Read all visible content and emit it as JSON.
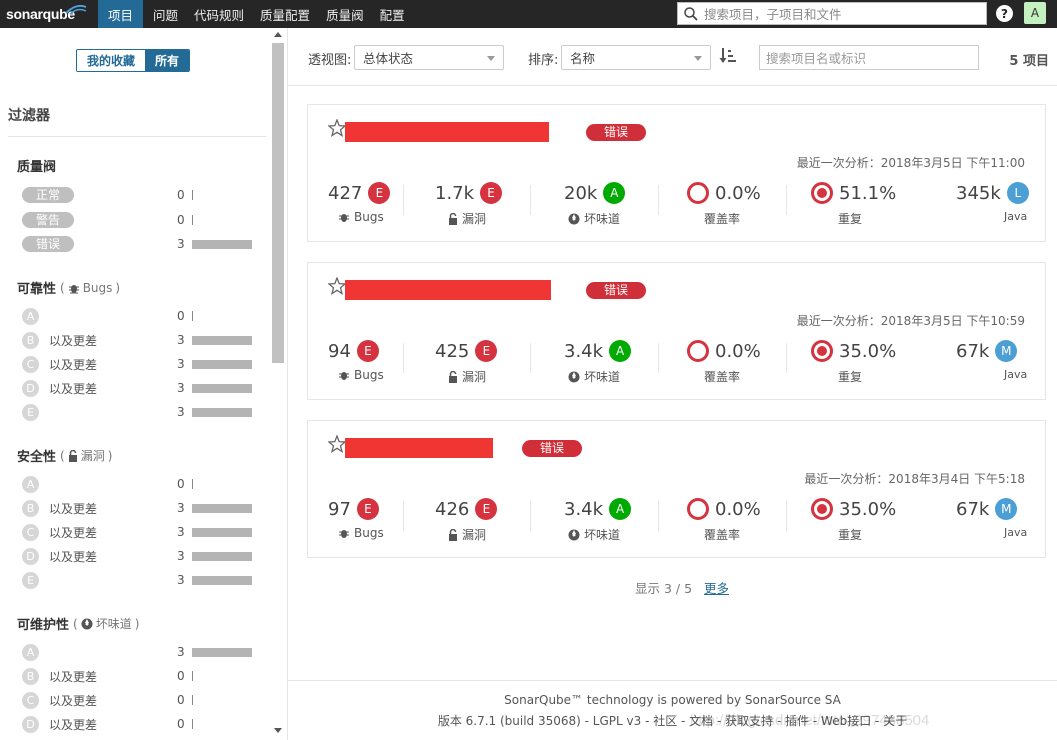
{
  "nav": {
    "logo": "sonarqube",
    "items": [
      "项目",
      "问题",
      "代码规则",
      "质量配置",
      "质量阀",
      "配置"
    ],
    "search_placeholder": "搜索项目，子项目和文件",
    "help": "?",
    "avatar": "A"
  },
  "sidebar": {
    "toggle": {
      "favorites": "我的收藏",
      "all": "所有"
    },
    "filter_title": "过滤器",
    "quality_gate": {
      "title": "质量阀",
      "rows": [
        {
          "label": "正常",
          "count": "0",
          "bar": 0
        },
        {
          "label": "警告",
          "count": "0",
          "bar": 0
        },
        {
          "label": "错误",
          "count": "3",
          "bar": 1
        }
      ]
    },
    "reliability": {
      "title": "可靠性",
      "sub": "Bugs",
      "rows": [
        {
          "rating": "A",
          "worse": "",
          "count": "0",
          "bar": 0
        },
        {
          "rating": "B",
          "worse": "以及更差",
          "count": "3",
          "bar": 1
        },
        {
          "rating": "C",
          "worse": "以及更差",
          "count": "3",
          "bar": 1
        },
        {
          "rating": "D",
          "worse": "以及更差",
          "count": "3",
          "bar": 1
        },
        {
          "rating": "E",
          "worse": "",
          "count": "3",
          "bar": 1
        }
      ]
    },
    "security": {
      "title": "安全性",
      "sub": "漏洞",
      "rows": [
        {
          "rating": "A",
          "worse": "",
          "count": "0",
          "bar": 0
        },
        {
          "rating": "B",
          "worse": "以及更差",
          "count": "3",
          "bar": 1
        },
        {
          "rating": "C",
          "worse": "以及更差",
          "count": "3",
          "bar": 1
        },
        {
          "rating": "D",
          "worse": "以及更差",
          "count": "3",
          "bar": 1
        },
        {
          "rating": "E",
          "worse": "",
          "count": "3",
          "bar": 1
        }
      ]
    },
    "maintainability": {
      "title": "可维护性",
      "sub": "坏味道",
      "rows": [
        {
          "rating": "A",
          "worse": "",
          "count": "3",
          "bar": 1
        },
        {
          "rating": "B",
          "worse": "以及更差",
          "count": "0",
          "bar": 0
        },
        {
          "rating": "C",
          "worse": "以及更差",
          "count": "0",
          "bar": 0
        },
        {
          "rating": "D",
          "worse": "以及更差",
          "count": "0",
          "bar": 0
        }
      ]
    }
  },
  "toolbar": {
    "perspective_label": "透视图:",
    "perspective_value": "总体状态",
    "sort_label": "排序:",
    "sort_value": "名称",
    "search_placeholder": "搜索项目名或标识",
    "count": "5 项目"
  },
  "projects": [
    {
      "status": "错误",
      "analysis": "最近一次分析：2018年3月5日 下午11:00",
      "bugs": "427",
      "bugs_rating": "E",
      "bugs_label": "Bugs",
      "vuln": "1.7k",
      "vuln_rating": "E",
      "vuln_label": "漏洞",
      "smells": "20k",
      "smells_rating": "A",
      "smells_label": "坏味道",
      "coverage": "0.0%",
      "coverage_label": "覆盖率",
      "dup": "51.1%",
      "dup_label": "重复",
      "size": "345k",
      "lang": "L",
      "lang_label": "Java"
    },
    {
      "status": "错误",
      "analysis": "最近一次分析：2018年3月5日 下午10:59",
      "bugs": "94",
      "bugs_rating": "E",
      "bugs_label": "Bugs",
      "vuln": "425",
      "vuln_rating": "E",
      "vuln_label": "漏洞",
      "smells": "3.4k",
      "smells_rating": "A",
      "smells_label": "坏味道",
      "coverage": "0.0%",
      "coverage_label": "覆盖率",
      "dup": "35.0%",
      "dup_label": "重复",
      "size": "67k",
      "lang": "M",
      "lang_label": "Java"
    },
    {
      "status": "错误",
      "analysis": "最近一次分析：2018年3月4日 下午5:18",
      "bugs": "97",
      "bugs_rating": "E",
      "bugs_label": "Bugs",
      "vuln": "426",
      "vuln_rating": "E",
      "vuln_label": "漏洞",
      "smells": "3.4k",
      "smells_rating": "A",
      "smells_label": "坏味道",
      "coverage": "0.0%",
      "coverage_label": "覆盖率",
      "dup": "35.0%",
      "dup_label": "重复",
      "size": "67k",
      "lang": "M",
      "lang_label": "Java"
    }
  ],
  "pager": {
    "text": "显示 3 / 5",
    "more": "更多"
  },
  "footer": {
    "line1": "SonarQube™ technology is powered by SonarSource SA",
    "line2": "版本 6.7.1 (build 35068) - LGPL v3 - 社区 - 文档 - 获取支持 - 插件 - Web接口 - 关于"
  },
  "watermark": "http://blog.csdn.net/toto1297488504",
  "colors": {
    "brand_blue": "#236a97",
    "error_red": "#d02f3a",
    "rating_e": "#d4333f",
    "rating_a": "#00aa00",
    "size_blue": "#4b9fd5"
  }
}
